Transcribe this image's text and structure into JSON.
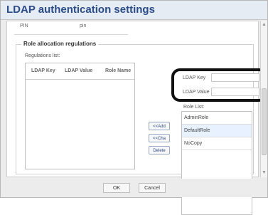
{
  "dialog": {
    "title": "LDAP authentication settings"
  },
  "pin": {
    "label": "PIN",
    "value": "pin"
  },
  "role_allocation": {
    "title": "Role allocation regulations",
    "regulations_label": "Regulations list:",
    "table_headers": [
      "LDAP Key",
      "LDAP Value",
      "Role Name"
    ],
    "buttons": {
      "add": "<<Add",
      "change": "<<Cha",
      "delete": "Delete"
    },
    "ldap_key_label": "LDAP Key",
    "ldap_value_label": "LDAP Value",
    "role_list_label": "Role List:",
    "roles": [
      "AdminRole",
      "DefaultRole",
      "NoCopy"
    ]
  },
  "footer": {
    "ok": "OK",
    "cancel": "Cancel"
  },
  "icons": {
    "scroll_up": "chevron-up-icon",
    "scroll_down": "chevron-down-icon"
  }
}
